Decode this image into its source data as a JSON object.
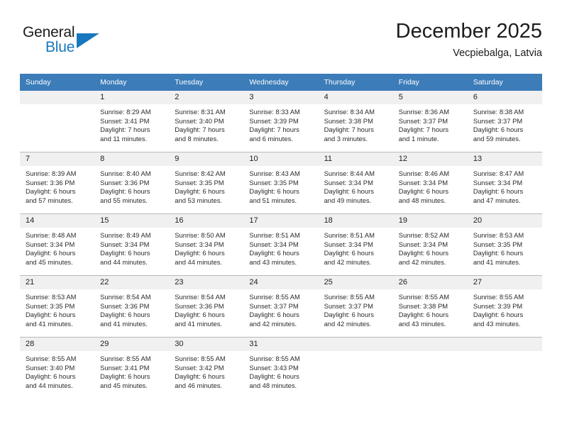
{
  "brand": {
    "name_top": "General",
    "name_bottom": "Blue",
    "triangle_color": "#1878be"
  },
  "header": {
    "title": "December 2025",
    "subtitle": "Vecpiebalga, Latvia"
  },
  "theme": {
    "header_blue": "#3b7cb9",
    "daynum_band": "#f0f0f0",
    "grid_line": "#b9b9b9"
  },
  "weekday_headers": [
    "Sunday",
    "Monday",
    "Tuesday",
    "Wednesday",
    "Thursday",
    "Friday",
    "Saturday"
  ],
  "weeks": [
    [
      {
        "day": "",
        "lines": []
      },
      {
        "day": "1",
        "lines": [
          "Sunrise: 8:29 AM",
          "Sunset: 3:41 PM",
          "Daylight: 7 hours",
          "and 11 minutes."
        ]
      },
      {
        "day": "2",
        "lines": [
          "Sunrise: 8:31 AM",
          "Sunset: 3:40 PM",
          "Daylight: 7 hours",
          "and 8 minutes."
        ]
      },
      {
        "day": "3",
        "lines": [
          "Sunrise: 8:33 AM",
          "Sunset: 3:39 PM",
          "Daylight: 7 hours",
          "and 6 minutes."
        ]
      },
      {
        "day": "4",
        "lines": [
          "Sunrise: 8:34 AM",
          "Sunset: 3:38 PM",
          "Daylight: 7 hours",
          "and 3 minutes."
        ]
      },
      {
        "day": "5",
        "lines": [
          "Sunrise: 8:36 AM",
          "Sunset: 3:37 PM",
          "Daylight: 7 hours",
          "and 1 minute."
        ]
      },
      {
        "day": "6",
        "lines": [
          "Sunrise: 8:38 AM",
          "Sunset: 3:37 PM",
          "Daylight: 6 hours",
          "and 59 minutes."
        ]
      }
    ],
    [
      {
        "day": "7",
        "lines": [
          "Sunrise: 8:39 AM",
          "Sunset: 3:36 PM",
          "Daylight: 6 hours",
          "and 57 minutes."
        ]
      },
      {
        "day": "8",
        "lines": [
          "Sunrise: 8:40 AM",
          "Sunset: 3:36 PM",
          "Daylight: 6 hours",
          "and 55 minutes."
        ]
      },
      {
        "day": "9",
        "lines": [
          "Sunrise: 8:42 AM",
          "Sunset: 3:35 PM",
          "Daylight: 6 hours",
          "and 53 minutes."
        ]
      },
      {
        "day": "10",
        "lines": [
          "Sunrise: 8:43 AM",
          "Sunset: 3:35 PM",
          "Daylight: 6 hours",
          "and 51 minutes."
        ]
      },
      {
        "day": "11",
        "lines": [
          "Sunrise: 8:44 AM",
          "Sunset: 3:34 PM",
          "Daylight: 6 hours",
          "and 49 minutes."
        ]
      },
      {
        "day": "12",
        "lines": [
          "Sunrise: 8:46 AM",
          "Sunset: 3:34 PM",
          "Daylight: 6 hours",
          "and 48 minutes."
        ]
      },
      {
        "day": "13",
        "lines": [
          "Sunrise: 8:47 AM",
          "Sunset: 3:34 PM",
          "Daylight: 6 hours",
          "and 47 minutes."
        ]
      }
    ],
    [
      {
        "day": "14",
        "lines": [
          "Sunrise: 8:48 AM",
          "Sunset: 3:34 PM",
          "Daylight: 6 hours",
          "and 45 minutes."
        ]
      },
      {
        "day": "15",
        "lines": [
          "Sunrise: 8:49 AM",
          "Sunset: 3:34 PM",
          "Daylight: 6 hours",
          "and 44 minutes."
        ]
      },
      {
        "day": "16",
        "lines": [
          "Sunrise: 8:50 AM",
          "Sunset: 3:34 PM",
          "Daylight: 6 hours",
          "and 44 minutes."
        ]
      },
      {
        "day": "17",
        "lines": [
          "Sunrise: 8:51 AM",
          "Sunset: 3:34 PM",
          "Daylight: 6 hours",
          "and 43 minutes."
        ]
      },
      {
        "day": "18",
        "lines": [
          "Sunrise: 8:51 AM",
          "Sunset: 3:34 PM",
          "Daylight: 6 hours",
          "and 42 minutes."
        ]
      },
      {
        "day": "19",
        "lines": [
          "Sunrise: 8:52 AM",
          "Sunset: 3:34 PM",
          "Daylight: 6 hours",
          "and 42 minutes."
        ]
      },
      {
        "day": "20",
        "lines": [
          "Sunrise: 8:53 AM",
          "Sunset: 3:35 PM",
          "Daylight: 6 hours",
          "and 41 minutes."
        ]
      }
    ],
    [
      {
        "day": "21",
        "lines": [
          "Sunrise: 8:53 AM",
          "Sunset: 3:35 PM",
          "Daylight: 6 hours",
          "and 41 minutes."
        ]
      },
      {
        "day": "22",
        "lines": [
          "Sunrise: 8:54 AM",
          "Sunset: 3:36 PM",
          "Daylight: 6 hours",
          "and 41 minutes."
        ]
      },
      {
        "day": "23",
        "lines": [
          "Sunrise: 8:54 AM",
          "Sunset: 3:36 PM",
          "Daylight: 6 hours",
          "and 41 minutes."
        ]
      },
      {
        "day": "24",
        "lines": [
          "Sunrise: 8:55 AM",
          "Sunset: 3:37 PM",
          "Daylight: 6 hours",
          "and 42 minutes."
        ]
      },
      {
        "day": "25",
        "lines": [
          "Sunrise: 8:55 AM",
          "Sunset: 3:37 PM",
          "Daylight: 6 hours",
          "and 42 minutes."
        ]
      },
      {
        "day": "26",
        "lines": [
          "Sunrise: 8:55 AM",
          "Sunset: 3:38 PM",
          "Daylight: 6 hours",
          "and 43 minutes."
        ]
      },
      {
        "day": "27",
        "lines": [
          "Sunrise: 8:55 AM",
          "Sunset: 3:39 PM",
          "Daylight: 6 hours",
          "and 43 minutes."
        ]
      }
    ],
    [
      {
        "day": "28",
        "lines": [
          "Sunrise: 8:55 AM",
          "Sunset: 3:40 PM",
          "Daylight: 6 hours",
          "and 44 minutes."
        ]
      },
      {
        "day": "29",
        "lines": [
          "Sunrise: 8:55 AM",
          "Sunset: 3:41 PM",
          "Daylight: 6 hours",
          "and 45 minutes."
        ]
      },
      {
        "day": "30",
        "lines": [
          "Sunrise: 8:55 AM",
          "Sunset: 3:42 PM",
          "Daylight: 6 hours",
          "and 46 minutes."
        ]
      },
      {
        "day": "31",
        "lines": [
          "Sunrise: 8:55 AM",
          "Sunset: 3:43 PM",
          "Daylight: 6 hours",
          "and 48 minutes."
        ]
      },
      {
        "day": "",
        "lines": []
      },
      {
        "day": "",
        "lines": []
      },
      {
        "day": "",
        "lines": []
      }
    ]
  ]
}
